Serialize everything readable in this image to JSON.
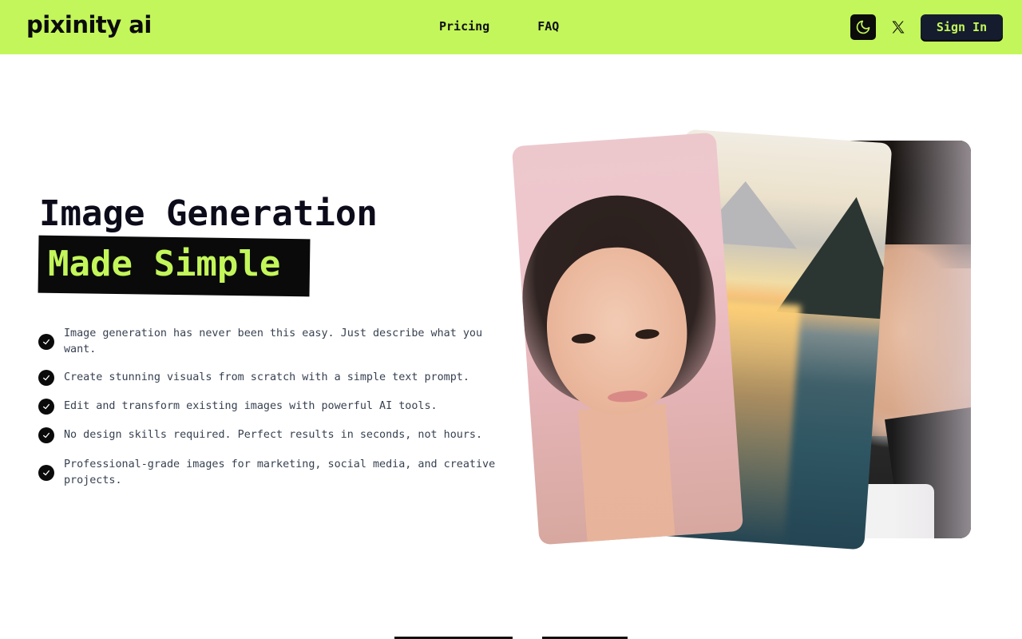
{
  "header": {
    "logo": "pixinity ai",
    "nav": [
      {
        "label": "Pricing"
      },
      {
        "label": "FAQ"
      }
    ],
    "theme_toggle_icon": "moon-icon",
    "social_icon": "x-logo-icon",
    "signin_label": "Sign In"
  },
  "hero": {
    "title_line1": "Image Generation",
    "title_line2": "Made Simple",
    "features": [
      {
        "text": "Image generation has never been this easy. Just describe what you want."
      },
      {
        "text": "Create stunning visuals from scratch with a simple text prompt."
      },
      {
        "text": "Edit and transform existing images with powerful AI tools."
      },
      {
        "text": "No design skills required. Perfect results in seconds, not hours."
      },
      {
        "text": "Professional-grade images for marketing, social media, and creative projects."
      }
    ],
    "images": [
      {
        "name": "portrait-man"
      },
      {
        "name": "landscape-lake"
      },
      {
        "name": "portrait-woman"
      }
    ]
  },
  "colors": {
    "accent": "#c3f65a",
    "dark": "#141c2e",
    "black": "#0a0a0a"
  }
}
